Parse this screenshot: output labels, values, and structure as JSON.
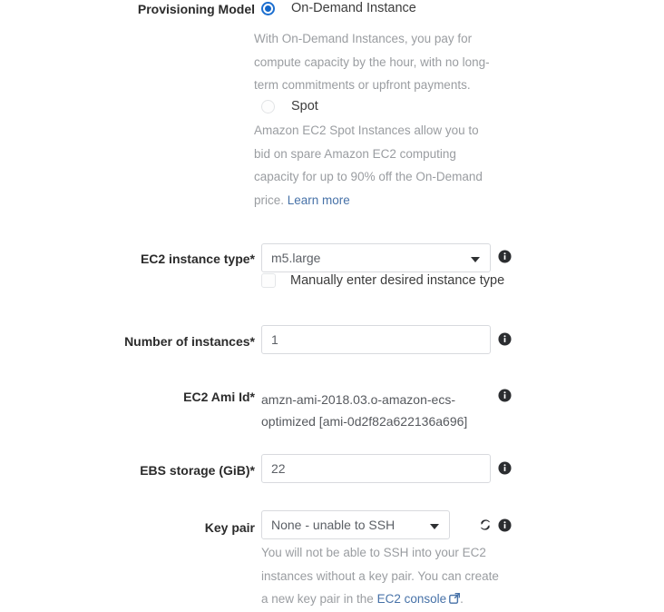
{
  "form": {
    "provisioning": {
      "label": "Provisioning Model",
      "options": [
        {
          "value": "on-demand",
          "label": "On-Demand Instance",
          "selected": true,
          "description": "With On-Demand Instances, you pay for compute capacity by the hour, with no long-term commitments or upfront payments."
        },
        {
          "value": "spot",
          "label": "Spot",
          "selected": false,
          "description": "Amazon EC2 Spot Instances allow you to bid on spare Amazon EC2 computing capacity for up to 90% off the On-Demand price. ",
          "link_text": "Learn more"
        }
      ]
    },
    "instance_type": {
      "label": "EC2 instance type*",
      "value": "m5.large",
      "manual_checkbox_label": "Manually enter desired instance type",
      "manual_checked": false,
      "info_icon": "info-icon"
    },
    "number_of_instances": {
      "label": "Number of instances*",
      "value": "1",
      "info_icon": "info-icon"
    },
    "ami_id": {
      "label": "EC2 Ami Id*",
      "value": "amzn-ami-2018.03.o-amazon-ecs-optimized [ami-0d2f82a622136a696]",
      "info_icon": "info-icon"
    },
    "ebs_storage": {
      "label": "EBS storage (GiB)*",
      "value": "22",
      "info_icon": "info-icon"
    },
    "key_pair": {
      "label": "Key pair",
      "value": "None - unable to SSH",
      "refresh_icon": "refresh-icon",
      "info_icon": "info-icon",
      "help_prefix": "You will not be able to SSH into your EC2 instances without a key pair. You can create a new key pair in the ",
      "help_link_text": "EC2 console",
      "help_suffix": "."
    }
  },
  "colors": {
    "accent_blue": "#1266c9",
    "link_blue": "#4772a8",
    "label_text": "#2b2b2b",
    "help_text": "#9a9da1",
    "field_border": "#d8dade"
  }
}
